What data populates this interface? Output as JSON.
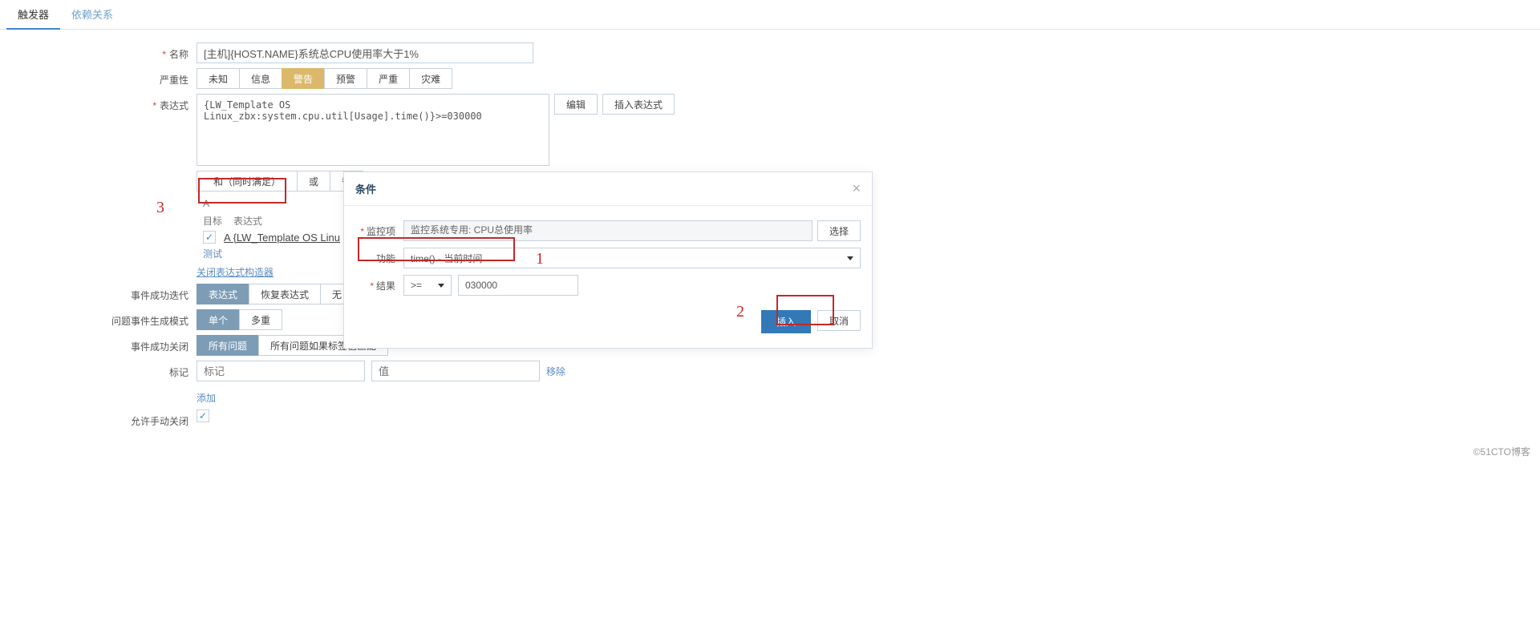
{
  "tabs": {
    "trigger": "触发器",
    "deps": "依赖关系"
  },
  "fields": {
    "name_label": "名称",
    "name_value": "[主机]{HOST.NAME}系统总CPU使用率大于1%",
    "severity_label": "严重性",
    "sev": {
      "unknown": "未知",
      "info": "信息",
      "warn": "警告",
      "avg": "预警",
      "high": "严重",
      "disaster": "灾难"
    },
    "expr_label": "表达式",
    "expr_value": "{LW_Template OS Linux_zbx:system.cpu.util[Usage].time()}>=030000",
    "expr_edit": "编辑",
    "expr_insert": "插入表达式",
    "and_label": "和（同时满足）",
    "or_label": "或",
    "replace_label": "替",
    "letter_a": "A",
    "target_label": "目标",
    "expr_col_label": "表达式",
    "row_a_text": "A  {LW_Template OS Linu",
    "test_link": "测试",
    "close_builder": "关闭表达式构造器",
    "event_iter_label": "事件成功迭代",
    "iter": {
      "expr": "表达式",
      "recover": "恢复表达式",
      "none": "无"
    },
    "problem_mode_label": "问题事件生成模式",
    "pm": {
      "single": "单个",
      "multi": "多重"
    },
    "ok_close_label": "事件成功关闭",
    "okc": {
      "all": "所有问题",
      "matched": "所有问题如果标签值匹配"
    },
    "tags_label": "标记",
    "tags": {
      "name_ph": "标记",
      "value_ph": "值",
      "remove": "移除",
      "add": "添加"
    },
    "allow_close_label": "允许手动关闭",
    "check": "✓"
  },
  "dialog": {
    "title": "条件",
    "item_label": "监控项",
    "item_value": "监控系统专用: CPU总使用率",
    "item_select": "选择",
    "func_label": "功能",
    "func_value": "time() - 当前时间",
    "result_label": "结果",
    "op_value": ">=",
    "result_value": "030000",
    "insert": "插入",
    "cancel": "取消"
  },
  "annotations": {
    "one": "1",
    "two": "2",
    "three": "3"
  },
  "watermark": "©51CTO博客"
}
